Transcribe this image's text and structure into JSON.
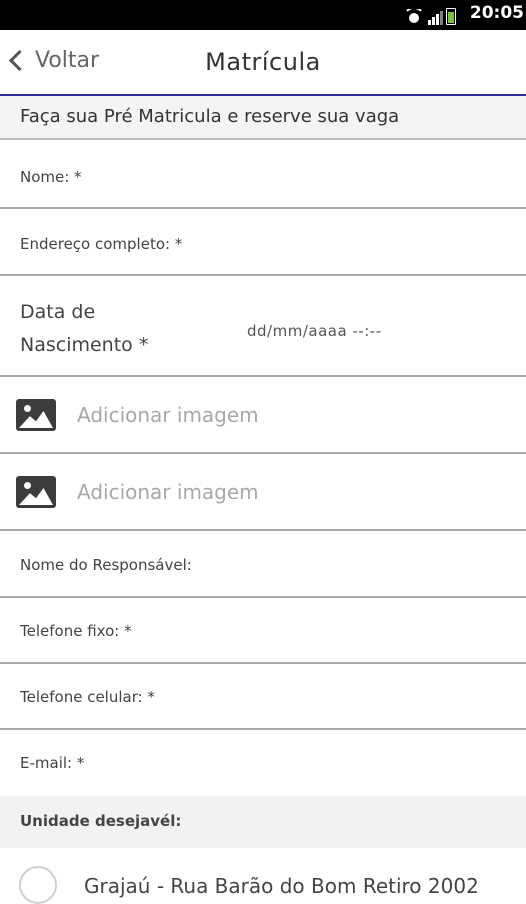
{
  "status_bar": {
    "time": "20:05",
    "icons": [
      "wifi-icon",
      "signal-icon",
      "battery-icon"
    ],
    "battery_color": "#7cc23a"
  },
  "app_bar": {
    "back_label": "Voltar",
    "title": "Matrícula",
    "accent_color": "#2a2a9a"
  },
  "form": {
    "intro": "Faça sua Pré Matricula e reserve sua vaga",
    "nome_label": "Nome: *",
    "endereco_label": "Endereço completo: *",
    "data_nascimento_label_line1": "Data de",
    "data_nascimento_label_line2": "Nascimento *",
    "data_nascimento_placeholder": "dd/mm/aaaa  --:--",
    "image_fields": [
      {
        "label": "Adicionar imagem",
        "icon": "image-icon"
      },
      {
        "label": "Adicionar imagem",
        "icon": "image-icon"
      }
    ],
    "responsavel_label": "Nome do Responsável:",
    "telefone_fixo_label": "Telefone fixo: *",
    "telefone_celular_label": "Telefone celular: *",
    "email_label": "E-mail: *",
    "unidade_header": "Unidade desejavél:",
    "unidades": [
      {
        "label": "Grajaú - Rua Barão do Bom Retiro 2002",
        "selected": false
      }
    ]
  }
}
